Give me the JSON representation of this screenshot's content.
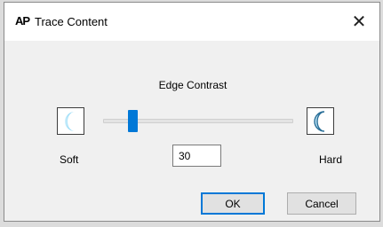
{
  "window": {
    "title": "Trace Content",
    "app_icon_text": "AP",
    "close_glyph": "✕"
  },
  "edge_contrast": {
    "caption": "Edge Contrast",
    "soft_label": "Soft",
    "hard_label": "Hard",
    "value": "30",
    "slider_position_fraction": 0.14
  },
  "icons": {
    "soft": "crescent-soft-icon",
    "hard": "crescent-hard-icon"
  },
  "buttons": {
    "ok_label": "OK",
    "cancel_label": "Cancel"
  },
  "colors": {
    "accent": "#0078d7",
    "soft_icon": "#7dd3f5",
    "hard_icon": "#9bd4f2"
  }
}
